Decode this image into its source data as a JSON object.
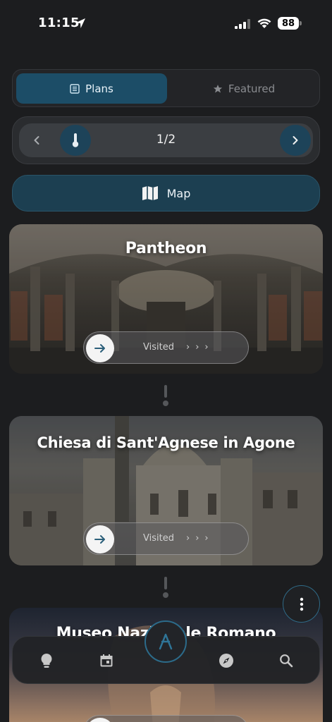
{
  "status_bar": {
    "time": "11:15",
    "battery": "88"
  },
  "segmented": {
    "plans_label": "Plans",
    "featured_label": "Featured"
  },
  "pager": {
    "label": "1/2"
  },
  "map_button": {
    "label": "Map"
  },
  "cards": [
    {
      "title": "Pantheon",
      "status": "Visited"
    },
    {
      "title": "Chiesa di Sant'Agnese in Agone",
      "status": "Visited"
    },
    {
      "title": "Museo Nazionale Romano"
    }
  ],
  "colors": {
    "accent": "#1c4d67",
    "background": "#1c1d1f",
    "ring": "#2c6b8a"
  },
  "icons": {
    "tabs": [
      "lightbulb-icon",
      "calendar-icon",
      "compass-icon",
      "search-icon"
    ],
    "center": "app-logo-icon",
    "more": "more-vertical-icon"
  }
}
